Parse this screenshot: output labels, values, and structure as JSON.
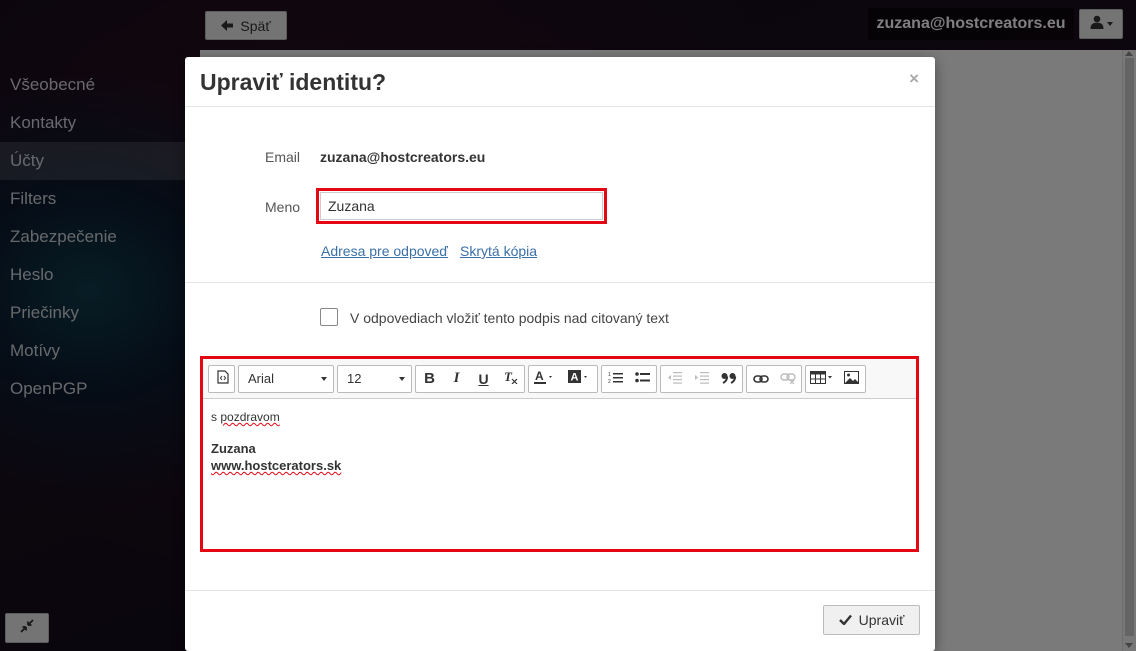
{
  "topbar": {
    "back_label": "Späť",
    "user_email": "zuzana@hostcreators.eu"
  },
  "sidebar": {
    "items": [
      {
        "label": "Všeobecné"
      },
      {
        "label": "Kontakty"
      },
      {
        "label": "Účty",
        "active": true
      },
      {
        "label": "Filters"
      },
      {
        "label": "Zabezpečenie"
      },
      {
        "label": "Heslo"
      },
      {
        "label": "Priečinky"
      },
      {
        "label": "Motívy"
      },
      {
        "label": "OpenPGP"
      }
    ]
  },
  "modal": {
    "title": "Upraviť identitu?",
    "close_label": "×",
    "email_label": "Email",
    "email_value": "zuzana@hostcreators.eu",
    "name_label": "Meno",
    "name_value": "Zuzana",
    "reply_to_link": "Adresa pre odpoveď",
    "bcc_link": "Skrytá kópia",
    "signature_above_label": "V odpovediach vložiť tento podpis nad citovaný text",
    "submit_label": "Upraviť"
  },
  "editor": {
    "font_family": "Arial",
    "font_size": "12",
    "signature_lines": {
      "greeting_prefix": "s ",
      "greeting_word": "pozdravom",
      "name": "Zuzana",
      "website": "www.hostcerators.sk"
    }
  },
  "colors": {
    "highlight": "#e30613",
    "link": "#3a6fa8"
  }
}
